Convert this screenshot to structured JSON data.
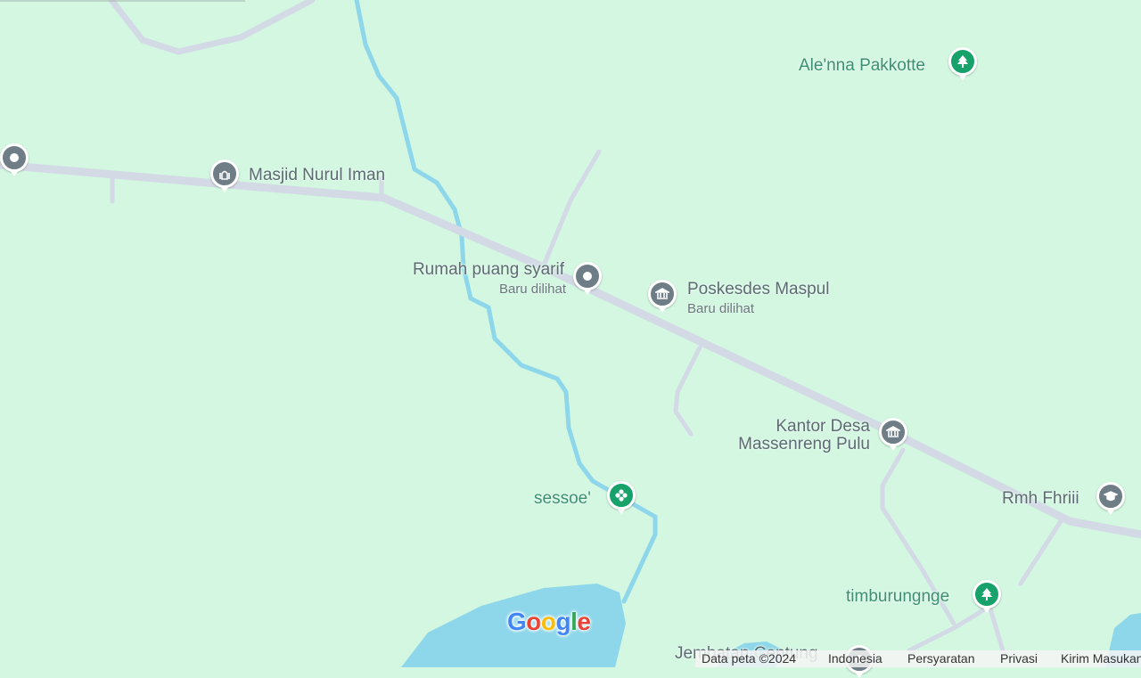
{
  "map": {
    "colors": {
      "land": "#d3f7e1",
      "road": "#d3dae6",
      "river": "#8ed7ea",
      "water": "#8ed7ea"
    },
    "places": [
      {
        "id": "alenna",
        "label": "Ale'nna Pakkotte",
        "icon": "tree-icon"
      },
      {
        "id": "masjid",
        "label": "Masjid Nurul Iman",
        "icon": "mosque-icon"
      },
      {
        "id": "rumah",
        "label": "Rumah puang syarif",
        "sub": "Baru dilihat",
        "icon": "location-pin-icon"
      },
      {
        "id": "poskesdes",
        "label": "Poskesdes Maspul",
        "sub": "Baru dilihat",
        "icon": "government-building-icon"
      },
      {
        "id": "kantor",
        "label_line1": "Kantor Desa",
        "label_line2": "Massenreng Pulu",
        "icon": "government-building-icon"
      },
      {
        "id": "rmh",
        "label": "Rmh Fhriii",
        "icon": "school-icon"
      },
      {
        "id": "sessoe",
        "label": "sessoe'",
        "icon": "flower-icon"
      },
      {
        "id": "timburungnge",
        "label": "timburungnge",
        "icon": "tree-icon"
      },
      {
        "id": "jembatan",
        "label": "Jembatan Centung",
        "icon": "location-pin-icon"
      }
    ],
    "logo": [
      "G",
      "o",
      "o",
      "g",
      "l",
      "e"
    ],
    "footer": {
      "data": "Data peta ©2024",
      "region": "Indonesia",
      "terms": "Persyaratan",
      "privacy": "Privasi",
      "feedback": "Kirim Masukan"
    }
  }
}
